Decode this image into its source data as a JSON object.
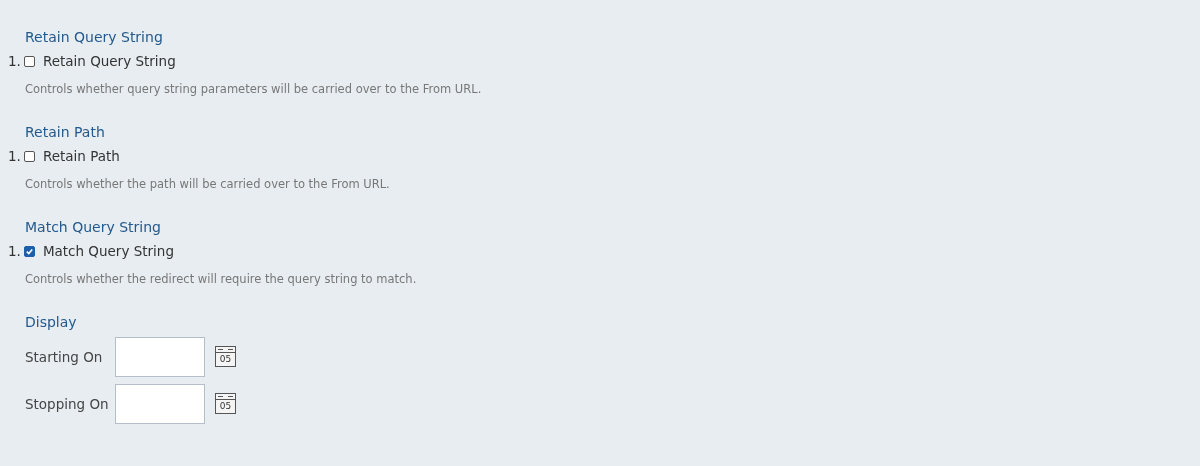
{
  "sections": [
    {
      "title": "Retain Query String",
      "options": [
        {
          "number": "1.",
          "label": "Retain Query String",
          "checked": false
        }
      ],
      "description": "Controls whether query string parameters will be carried over to the From URL."
    },
    {
      "title": "Retain Path",
      "options": [
        {
          "number": "1.",
          "label": "Retain Path",
          "checked": false
        }
      ],
      "description": "Controls whether the path will be carried over to the From URL."
    },
    {
      "title": "Match Query String",
      "options": [
        {
          "number": "1.",
          "label": "Match Query String",
          "checked": true
        }
      ],
      "description": "Controls whether the redirect will require the query string to match."
    }
  ],
  "display": {
    "title": "Display",
    "fields": [
      {
        "label": "Starting On",
        "calendar_text": "05"
      },
      {
        "label": "Stopping On",
        "calendar_text": "05"
      }
    ]
  }
}
